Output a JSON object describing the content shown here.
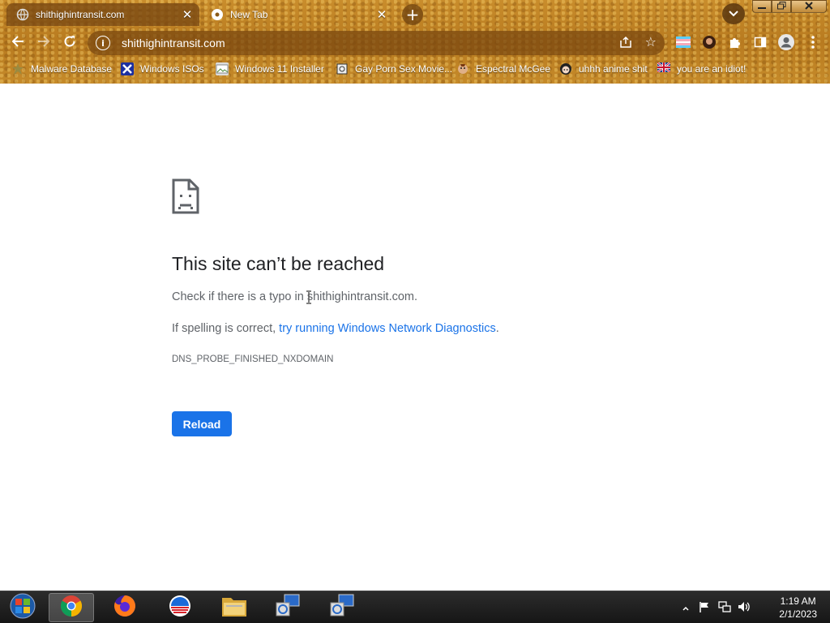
{
  "browser": {
    "tabs": [
      {
        "title": "shithighintransit.com",
        "active": true
      },
      {
        "title": "New Tab",
        "active": false
      }
    ],
    "new_tab_symbol": "+",
    "tab_close_symbol": "✕",
    "address": "shithighintransit.com",
    "bookmarks": [
      {
        "label": "Malware Database",
        "icon": "star-icon"
      },
      {
        "label": "Windows ISOs",
        "icon": "x-icon"
      },
      {
        "label": "Windows 11 Installer",
        "icon": "image-icon"
      },
      {
        "label": "Gay Porn Sex Movie...",
        "icon": "spiral-icon"
      },
      {
        "label": "Espectral McGee",
        "icon": "face-icon"
      },
      {
        "label": "uhhh anime shit",
        "icon": "anime-icon"
      },
      {
        "label": "you are an idiot!",
        "icon": "flag-icon"
      }
    ]
  },
  "error_page": {
    "title": "This site can’t be reached",
    "line1_prefix": "Check if there is a typo in ",
    "line1_domain": "shithighintransit.com",
    "line1_suffix": ".",
    "line2_prefix": "If spelling is correct, ",
    "line2_link": "try running Windows Network Diagnostics",
    "line2_suffix": ".",
    "error_code": "DNS_PROBE_FINISHED_NXDOMAIN",
    "reload_label": "Reload"
  },
  "taskbar": {
    "items": [
      "start-orb",
      "chrome",
      "firefox",
      "obama-logo",
      "file-explorer",
      "network-setup-1",
      "network-setup-2"
    ],
    "active_item": "chrome",
    "time": "1:19 AM",
    "date": "2/1/2023"
  },
  "colors": {
    "link": "#1a73e8",
    "button": "#1a73e8",
    "theme_gold": "#c98d2c"
  }
}
